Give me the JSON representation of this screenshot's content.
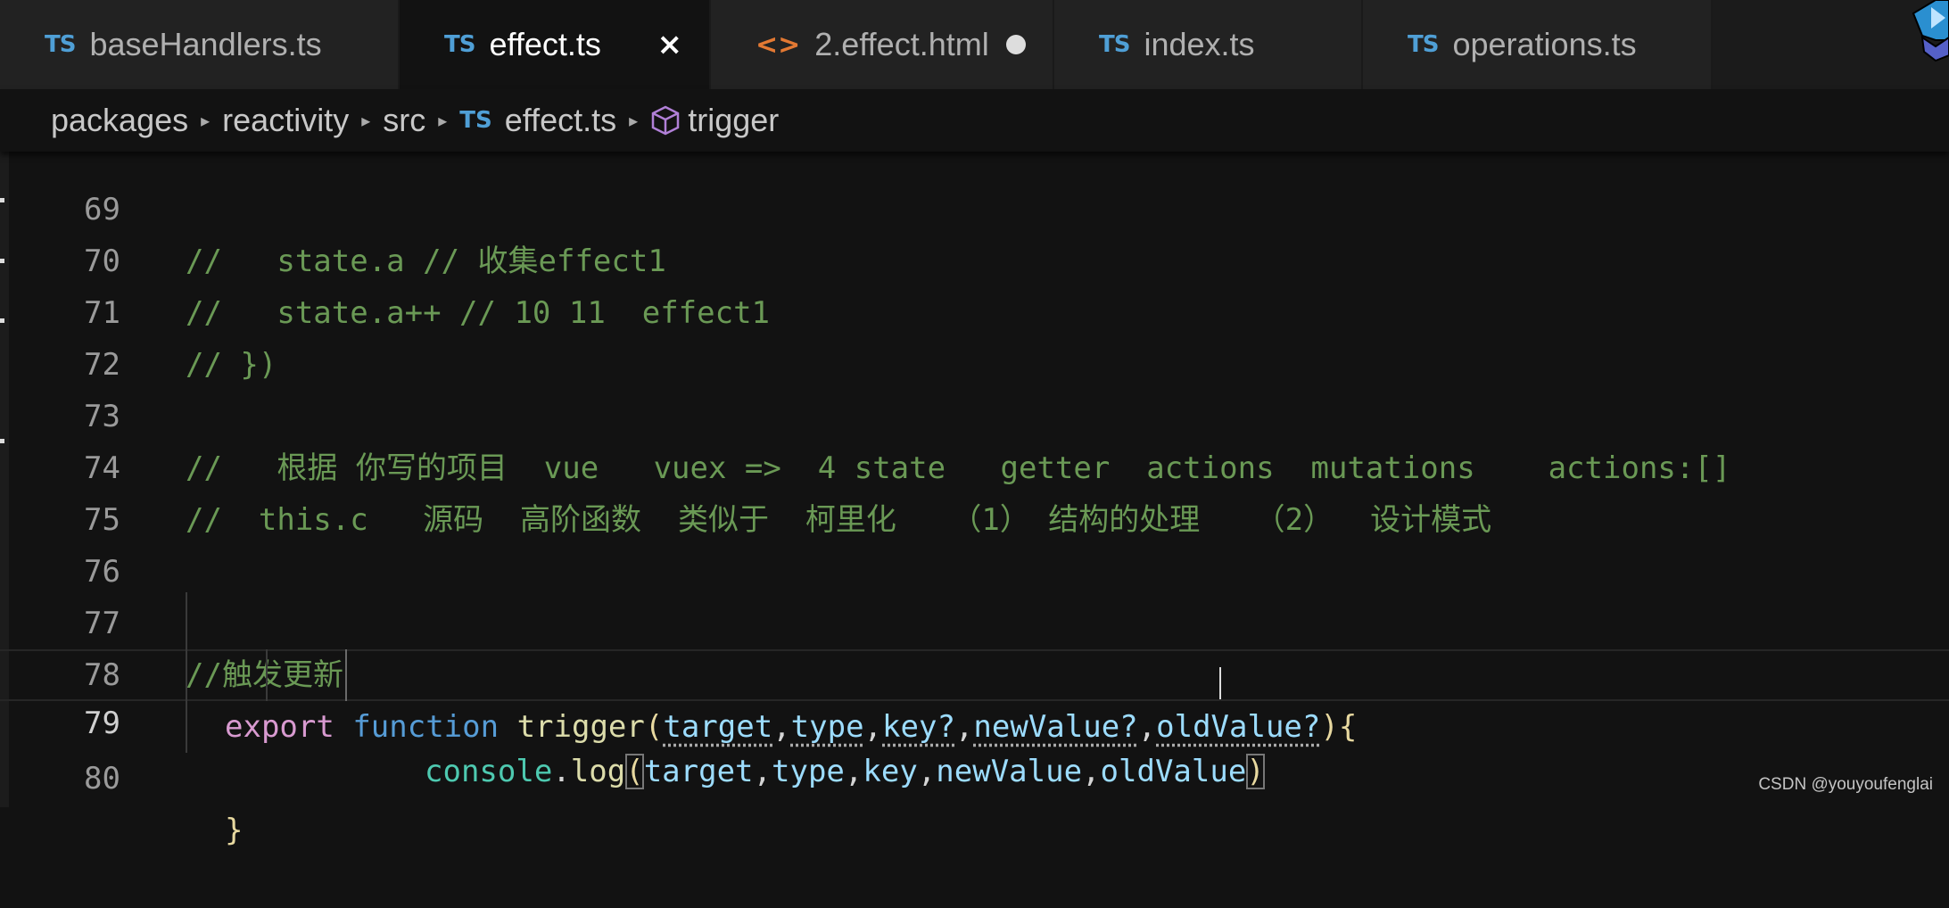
{
  "tabs": [
    {
      "icon": "TS",
      "label": "baseHandlers.ts",
      "active": false
    },
    {
      "icon": "TS",
      "label": "effect.ts",
      "active": true,
      "close": "×"
    },
    {
      "icon": "<>",
      "label": "2.effect.html",
      "active": false,
      "dirty": true
    },
    {
      "icon": "TS",
      "label": "index.ts",
      "active": false
    },
    {
      "icon": "TS",
      "label": "operations.ts",
      "active": false
    }
  ],
  "breadcrumb": {
    "items": [
      "packages",
      "reactivity",
      "src",
      "effect.ts",
      "trigger"
    ],
    "file_icon": "TS",
    "separator": "▸"
  },
  "editor": {
    "lines": [
      {
        "n": "69",
        "text": "//   state.a // 收集effect1"
      },
      {
        "n": "70",
        "text": "//   state.a++ // 10 11  effect1"
      },
      {
        "n": "71",
        "text": "// })"
      },
      {
        "n": "72",
        "text": ""
      },
      {
        "n": "73",
        "text": "//   根据 你写的项目  vue   vuex =>  4 state   getter  actions  mutations    actions:[]"
      },
      {
        "n": "74",
        "text": "//  this.c   源码  高阶函数  类似于  柯里化   （1） 结构的处理   （2）  设计模式"
      },
      {
        "n": "75",
        "text": ""
      },
      {
        "n": "76",
        "text": ""
      },
      {
        "n": "77",
        "text": "//触发更新"
      },
      {
        "n": "78",
        "kw": "export",
        "st": "function",
        "fn": "trigger",
        "params": [
          "target",
          "type",
          "key?",
          "newValue?",
          "oldValue?"
        ],
        "tail": "){"
      },
      {
        "n": "79",
        "obj": "console",
        "method": "log",
        "args": [
          "target",
          "type",
          "key",
          "newValue",
          "oldValue"
        ]
      },
      {
        "n": "80",
        "text": "}"
      }
    ],
    "current_line": "79"
  },
  "watermark": "CSDN @youyoufenglai",
  "colors": {
    "comment": "#6a9955",
    "keyword": "#d89ad0",
    "storage": "#569cd6",
    "function": "#dcdcaa",
    "parameter": "#9cdcfe",
    "class": "#4ec9b0",
    "ts_icon": "#4f9fd6",
    "html_icon": "#e37933"
  }
}
